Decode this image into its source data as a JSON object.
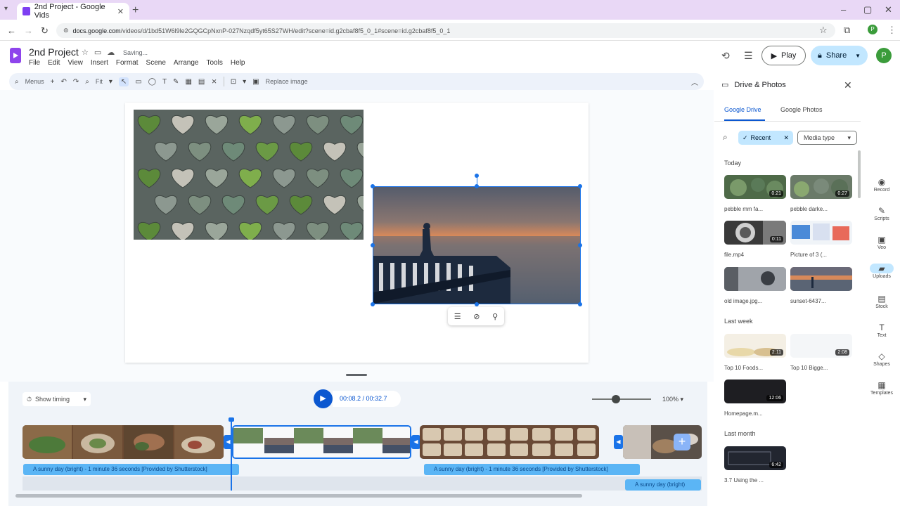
{
  "browser": {
    "tab_title": "2nd Project - Google Vids",
    "url_host": "docs.google.com",
    "url_rest": "/videos/d/1bd51W6l9le2GQGCpNxnP-027Nzqdf5yt65S27WH/edit?scene=id.g2cbaf8f5_0_1#scene=id.g2cbaf8f5_0_1"
  },
  "app": {
    "title": "2nd Project",
    "saving": "Saving...",
    "menu": [
      "File",
      "Edit",
      "View",
      "Insert",
      "Format",
      "Scene",
      "Arrange",
      "Tools",
      "Help"
    ],
    "play_label": "Play",
    "share_label": "Share",
    "avatar_initial": "P"
  },
  "toolbar": {
    "menus_label": "Menus",
    "zoom_value": "Fit",
    "replace_image": "Replace image"
  },
  "timeline": {
    "show_timing": "Show timing",
    "time_display": "00:08.2 / 00:32.7",
    "zoom_percent": "100%",
    "zoom_level": 0.4,
    "audio_track_1": "A sunny day (bright) - 1 minute 36 seconds [Provided by Shutterstock]",
    "audio_track_2": "A sunny day (bright) - 1 minute 36 seconds [Provided by Shutterstock]",
    "audio_track_3": "A sunny day (bright)"
  },
  "panel": {
    "title": "Drive & Photos",
    "tab_drive": "Google Drive",
    "tab_photos": "Google Photos",
    "chip_recent": "Recent",
    "chip_media": "Media type",
    "section_today": "Today",
    "section_last_week": "Last week",
    "section_last_month": "Last month",
    "items": [
      {
        "name": "pebble mm fa...",
        "dur": "0:21"
      },
      {
        "name": "pebble darke...",
        "dur": "0:27"
      },
      {
        "name": "file.mp4",
        "dur": "0:11"
      },
      {
        "name": "Picture of 3 (...",
        "dur": ""
      },
      {
        "name": "old image.jpg...",
        "dur": ""
      },
      {
        "name": "sunset-6437...",
        "dur": ""
      },
      {
        "name": "Top 10 Foods...",
        "dur": "2:11"
      },
      {
        "name": "Top 10 Bigge...",
        "dur": "2:08"
      },
      {
        "name": "Homepage.m...",
        "dur": "12:06"
      },
      {
        "name": "3.7 Using the ...",
        "dur": "6:42"
      }
    ]
  },
  "rail": [
    "Record",
    "Scripts",
    "Veo",
    "Uploads",
    "Stock",
    "Text",
    "Shapes",
    "Templates"
  ],
  "colors": {
    "accent": "#0b57d0",
    "share_bg": "#c2e7ff",
    "audio": "#5bb5f5",
    "selection": "#1a73e8"
  }
}
